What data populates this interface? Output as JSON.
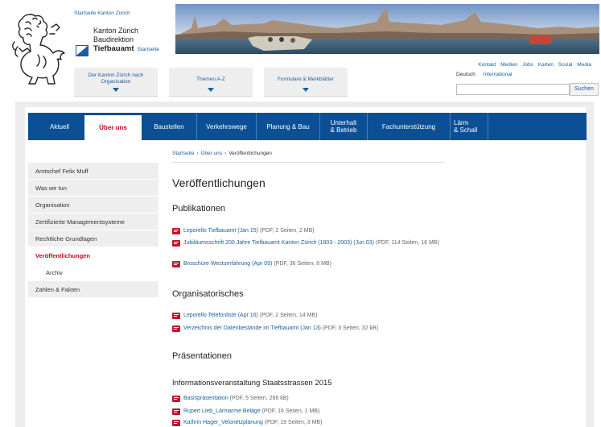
{
  "header": {
    "top_link": "Startseite Kanton Zürich",
    "kanton_line1": "Kanton Zürich",
    "kanton_line2": "Baudirektion",
    "office": "Tiefbauamt",
    "office_link": "Startseite"
  },
  "mega_tabs": [
    {
      "line1": "Der Kanton Zürich nach",
      "line2": "Organisation"
    },
    {
      "line1": "Themen A-Z",
      "line2": ""
    },
    {
      "line1": "Formulare & Merkblätter",
      "line2": ""
    }
  ],
  "util_links": [
    "Kontakt",
    "Medien",
    "Jobs",
    "Karten",
    "Social Media"
  ],
  "languages": {
    "current": "Deutsch",
    "other": "International"
  },
  "search": {
    "value": "",
    "button": "Suchen"
  },
  "main_nav": [
    {
      "line1": "Aktuell",
      "line2": ""
    },
    {
      "line1": "Über uns",
      "line2": ""
    },
    {
      "line1": "Baustellen",
      "line2": ""
    },
    {
      "line1": "Verkehrswege",
      "line2": ""
    },
    {
      "line1": "Planung & Bau",
      "line2": ""
    },
    {
      "line1": "Unterhalt",
      "line2": "& Betrieb"
    },
    {
      "line1": "Fachunterstützung",
      "line2": ""
    },
    {
      "line1": "Lärm",
      "line2": "& Schall"
    }
  ],
  "sidebar": [
    "Amtschef Felix Muff",
    "Was wir tun",
    "Organisation",
    "Zertifizierte Managementsysteme",
    "Rechtliche Grundlagen",
    "Veröffentlichungen",
    "Archiv",
    "Zahlen & Fakten"
  ],
  "breadcrumb": [
    "Startseite",
    "Über uns",
    "Veröffentlichungen"
  ],
  "page_title": "Veröffentlichungen",
  "sections": {
    "publikationen": "Publikationen",
    "organisatorisches": "Organisatorisches",
    "praesentationen": "Präsentationen",
    "infoveranstaltung": "Informationsveranstaltung Staatsstrassen 2015"
  },
  "docs": {
    "pub": [
      {
        "link": "Leporello Tiefbauamt (Jan 15)",
        "meta": "(PDF, 2 Seiten, 2 MB)"
      },
      {
        "link": "Jubiläumsschrift 200 Jahre Tiefbauamt Kanton Zürich (1803 - 2003) (Jun 03)",
        "meta": "(PDF, 114 Seiten, 16 MB)"
      },
      {
        "link": "Broschüre Westumfahrung (Apr 09)",
        "meta": "(PDF, 36 Seiten, 8 MB)"
      }
    ],
    "org": [
      {
        "link": "Leporello Telefonliste (Apr 16)",
        "meta": "(PDF, 2 Seiten, 14 MB)"
      },
      {
        "link": "Verzeichnis der Datenbestände im Tiefbauamt (Jan 13)",
        "meta": "(PDF, 3 Seiten, 32 kB)"
      }
    ],
    "info": [
      {
        "link": "Basispräsentation",
        "meta": "(PDF, 5 Seiten, 266 kB)"
      },
      {
        "link": "Rupert Lieb_Lärmarme Beläge",
        "meta": "(PDF, 16 Seiten, 1 MB)"
      },
      {
        "link": "Kathrin Hager_Velonetzplanung",
        "meta": "(PDF, 19 Seiten, 3 MB)"
      }
    ]
  },
  "colors": {
    "nav_blue": "#0b4f94",
    "active_red": "#c4081f",
    "link_blue": "#1a5e9e",
    "pdf_red": "#c8102e"
  }
}
